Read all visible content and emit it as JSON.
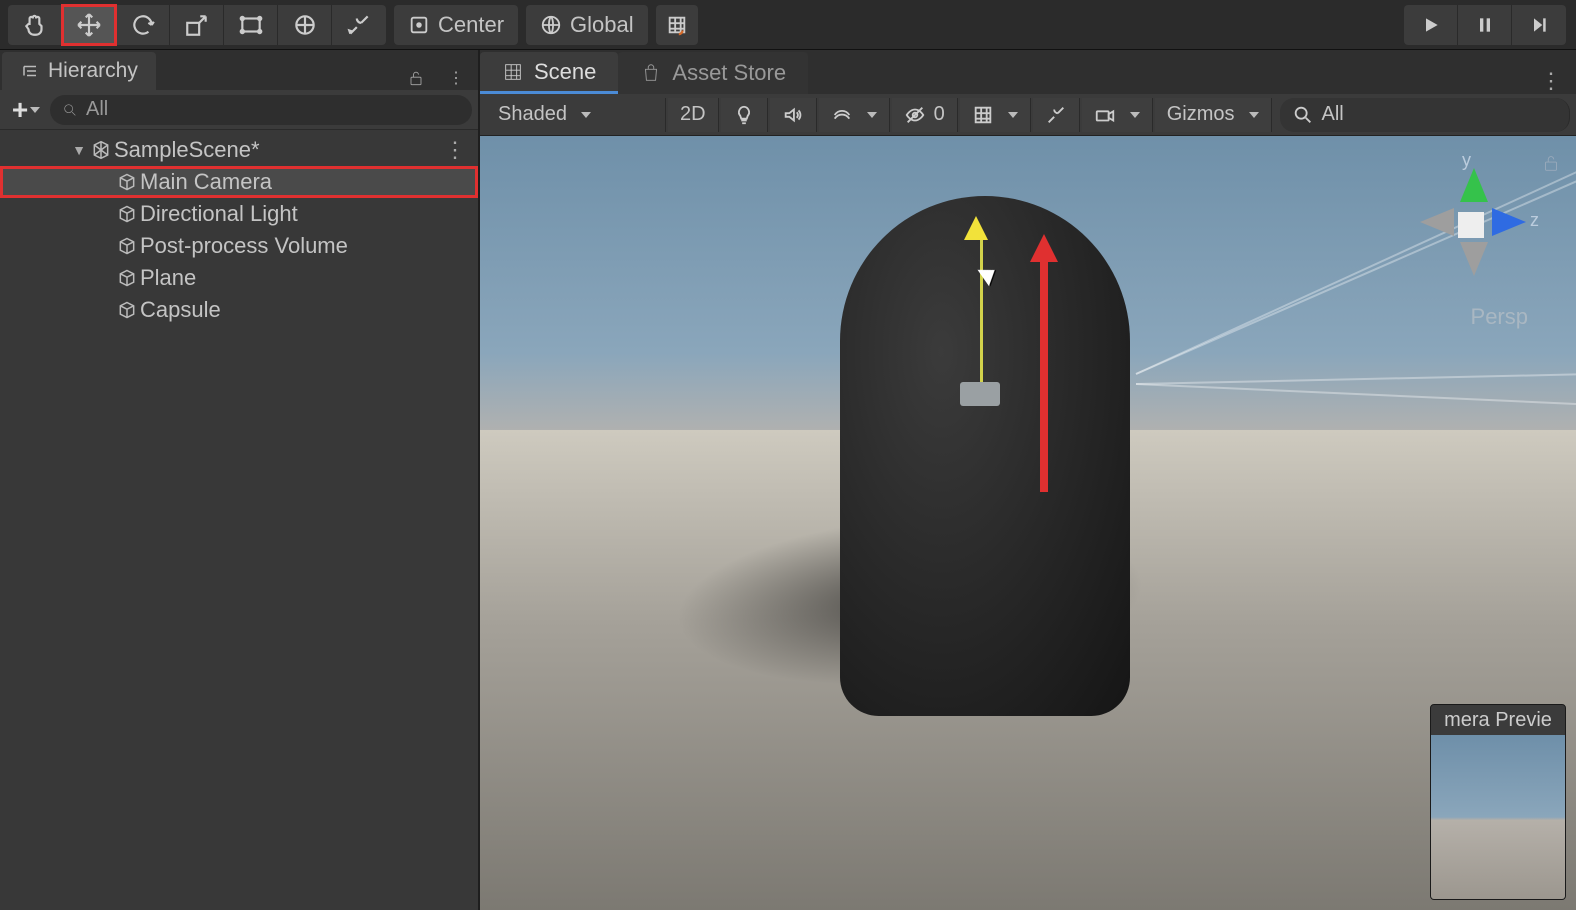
{
  "toolbar": {
    "pivot_label": "Center",
    "space_label": "Global"
  },
  "hierarchy": {
    "title": "Hierarchy",
    "search_placeholder": "All",
    "scene_name": "SampleScene*",
    "items": [
      {
        "label": "Main Camera",
        "selected": true,
        "highlight": true
      },
      {
        "label": "Directional Light",
        "selected": false,
        "highlight": false
      },
      {
        "label": "Post-process Volume",
        "selected": false,
        "highlight": false
      },
      {
        "label": "Plane",
        "selected": false,
        "highlight": false
      },
      {
        "label": "Capsule",
        "selected": false,
        "highlight": false
      }
    ]
  },
  "scene": {
    "tabs": {
      "scene": "Scene",
      "asset_store": "Asset Store"
    },
    "shading_mode": "Shaded",
    "btn_2d": "2D",
    "hidden_count": "0",
    "gizmos_label": "Gizmos",
    "search_placeholder": "All",
    "axes": {
      "y": "y",
      "z": "z"
    },
    "projection": "Persp",
    "camera_preview_title": "mera Previe"
  }
}
